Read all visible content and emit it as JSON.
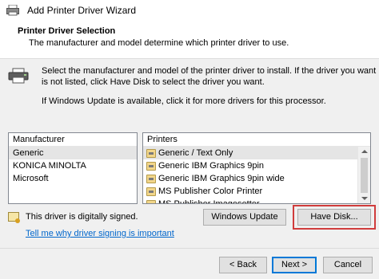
{
  "window": {
    "title": "Add Printer Driver Wizard",
    "icon": "printer-wizard-icon"
  },
  "header": {
    "title": "Printer Driver Selection",
    "subtitle": "The manufacturer and model determine which printer driver to use."
  },
  "instructions": {
    "line1": "Select the manufacturer and model of the printer driver to install. If the driver you want is not listed, click Have Disk to select the driver you want.",
    "line2": "If Windows Update is available, click it for more drivers for this processor.",
    "icon": "printer-icon"
  },
  "manufacturer_list": {
    "header": "Manufacturer",
    "items": [
      "Generic",
      "KONICA MINOLTA",
      "Microsoft"
    ],
    "selected": "Generic"
  },
  "printers_list": {
    "header": "Printers",
    "items": [
      "Generic / Text Only",
      "Generic IBM Graphics 9pin",
      "Generic IBM Graphics 9pin wide",
      "MS Publisher Color Printer",
      "MS Publisher Imagesetter"
    ],
    "selected": "Generic / Text Only",
    "item_icon": "printer-small-icon"
  },
  "signing": {
    "status_text": "This driver is digitally signed.",
    "link_text": "Tell me why driver signing is important",
    "icon": "certificate-icon"
  },
  "buttons": {
    "windows_update": "Windows Update",
    "have_disk": "Have Disk...",
    "back": "< Back",
    "next": "Next >",
    "cancel": "Cancel"
  },
  "colors": {
    "highlight": "#d03c3c",
    "link": "#0066cc",
    "default_button_border": "#0078d7"
  }
}
